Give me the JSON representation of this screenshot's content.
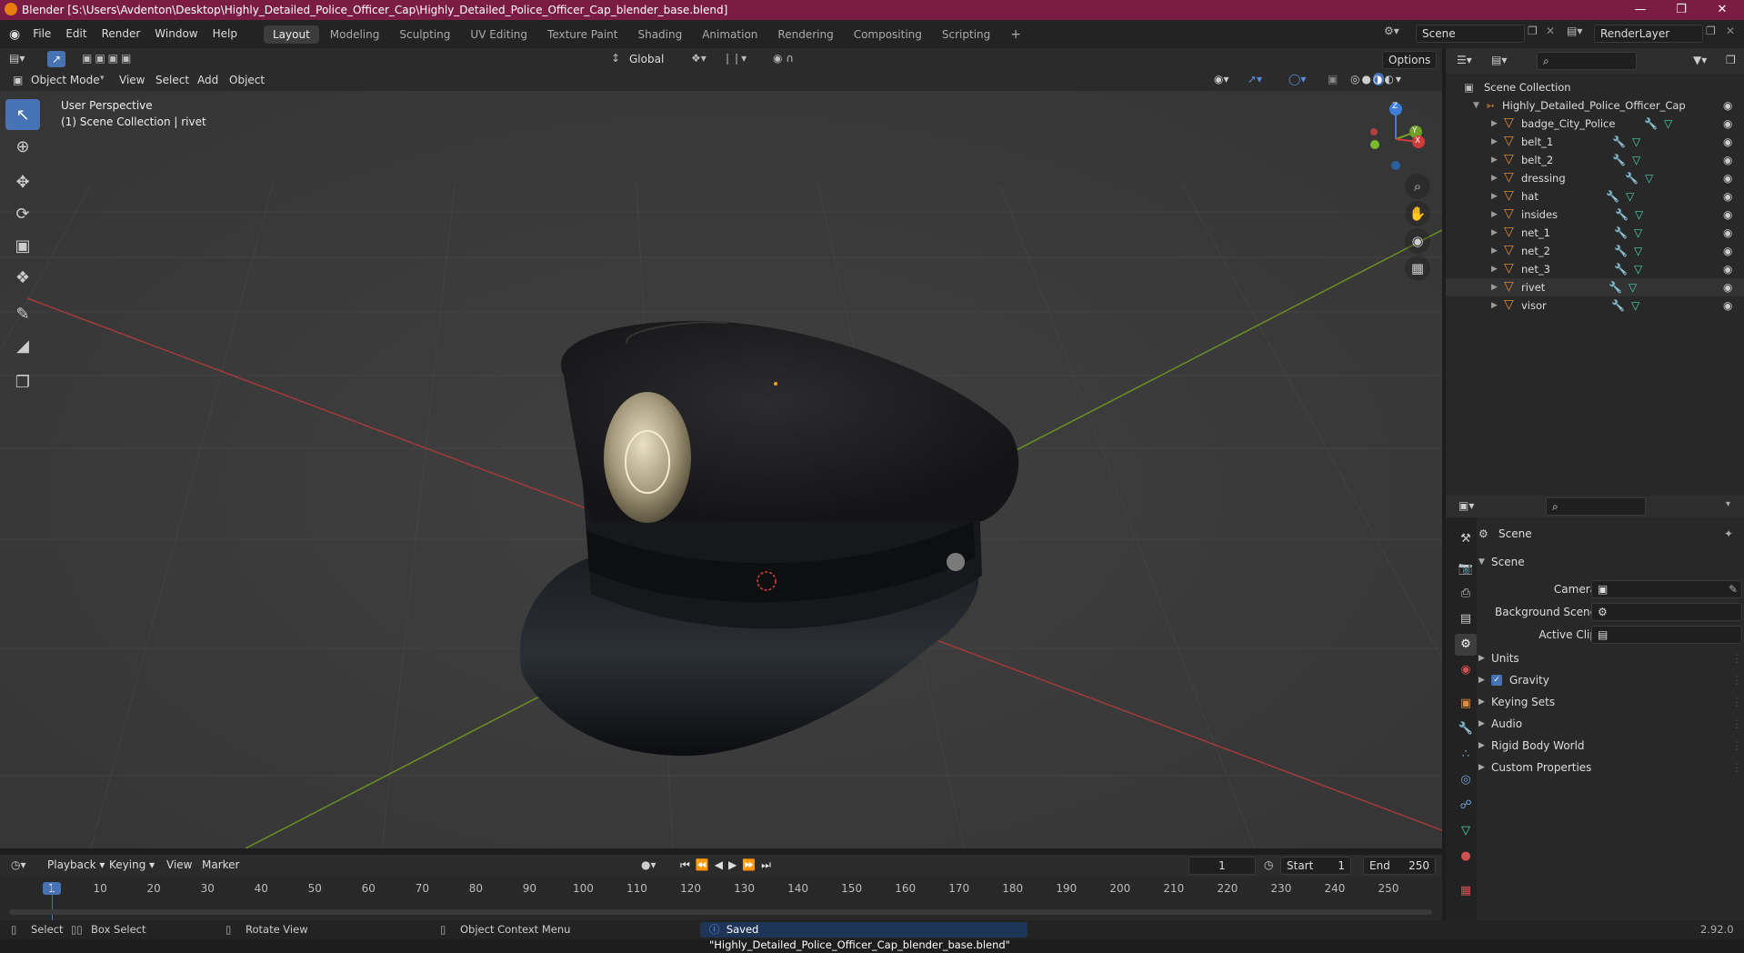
{
  "window": {
    "title": "Blender [S:\\Users\\Avdenton\\Desktop\\Highly_Detailed_Police_Officer_Cap\\Highly_Detailed_Police_Officer_Cap_blender_base.blend]"
  },
  "menu": [
    "File",
    "Edit",
    "Render",
    "Window",
    "Help"
  ],
  "workspaces": [
    "Layout",
    "Modeling",
    "Sculpting",
    "UV Editing",
    "Texture Paint",
    "Shading",
    "Animation",
    "Rendering",
    "Compositing",
    "Scripting"
  ],
  "scene_field": "Scene",
  "render_layer_field": "RenderLayer",
  "viewport": {
    "mode": "Object Mode",
    "menus": [
      "View",
      "Select",
      "Add",
      "Object"
    ],
    "transform_orientation": "Global",
    "options_label": "Options",
    "overlay_line1": "User Perspective",
    "overlay_line2": "(1) Scene Collection | rivet",
    "gizmo": {
      "z": "Z",
      "y": "Y",
      "x": "X"
    }
  },
  "outliner": {
    "root": "Scene Collection",
    "collection": "Highly_Detailed_Police_Officer_Cap",
    "objects": [
      "badge_City_Police",
      "belt_1",
      "belt_2",
      "dressing",
      "hat",
      "insides",
      "net_1",
      "net_2",
      "net_3",
      "rivet",
      "visor"
    ]
  },
  "properties": {
    "header": "Scene",
    "panel": "Scene",
    "camera_label": "Camera",
    "background_scene_label": "Background Scene",
    "active_clip_label": "Active Clip",
    "sections": [
      "Units",
      "Gravity",
      "Keying Sets",
      "Audio",
      "Rigid Body World",
      "Custom Properties"
    ],
    "gravity_checked": true
  },
  "timeline": {
    "menus": [
      "Playback",
      "Keying",
      "View",
      "Marker"
    ],
    "current_frame": "1",
    "start_label": "Start",
    "start_value": "1",
    "end_label": "End",
    "end_value": "250",
    "ticks": [
      "1",
      "10",
      "20",
      "30",
      "40",
      "50",
      "60",
      "70",
      "80",
      "90",
      "100",
      "110",
      "120",
      "130",
      "140",
      "150",
      "160",
      "170",
      "180",
      "190",
      "200",
      "210",
      "220",
      "230",
      "240",
      "250"
    ]
  },
  "statusbar": {
    "select": "Select",
    "box_select": "Box Select",
    "rotate_view": "Rotate View",
    "context_menu": "Object Context Menu",
    "message": "Saved \"Highly_Detailed_Police_Officer_Cap_blender_base.blend\"",
    "version": "2.92.0"
  }
}
